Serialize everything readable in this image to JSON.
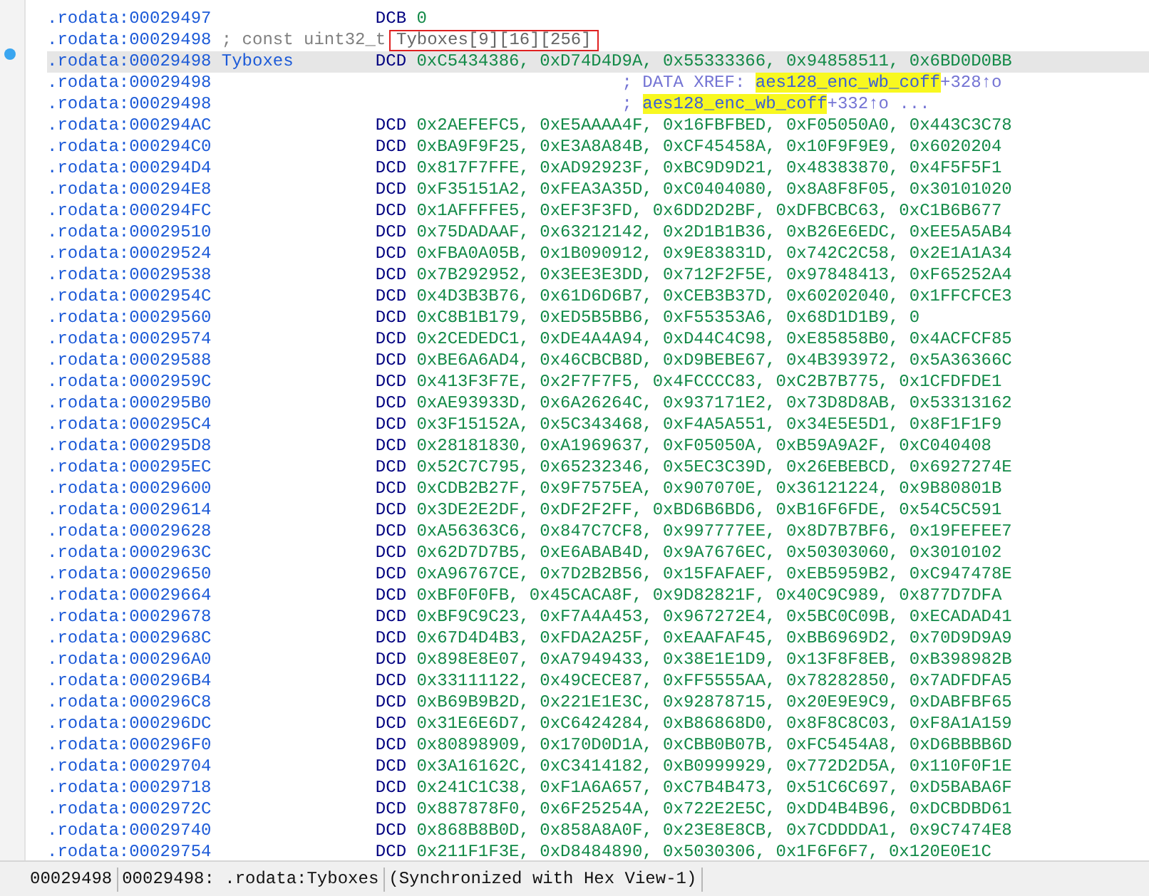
{
  "tooltip": {
    "text": "Tyboxes[9][16][256]"
  },
  "lines": [
    {
      "kind": "data",
      "address": ".rodata:00029497",
      "directive": "DCB",
      "operands": "0",
      "selected": false
    },
    {
      "kind": "comment",
      "address": ".rodata:00029498",
      "text": "; const uint32_t",
      "selected": false
    },
    {
      "kind": "data",
      "address": ".rodata:00029498",
      "label": "Tyboxes",
      "directive": "DCD",
      "operands": "0xC5434386, 0xD74D4D9A, 0x55333366, 0x94858511, 0x6BD0D0BB",
      "selected": true
    },
    {
      "kind": "xref",
      "address": ".rodata:00029498",
      "prefix": "; DATA XREF:",
      "target": "aes128_enc_wb_coff",
      "offset": "+328↑o",
      "selected": false
    },
    {
      "kind": "xref",
      "address": ".rodata:00029498",
      "prefix": ";",
      "target": "aes128_enc_wb_coff",
      "offset": "+332↑o ...",
      "selected": false
    },
    {
      "kind": "data",
      "address": ".rodata:000294AC",
      "directive": "DCD",
      "operands": "0x2AEFEFC5, 0xE5AAAA4F, 0x16FBFBED, 0xF05050A0, 0x443C3C78",
      "selected": false
    },
    {
      "kind": "data",
      "address": ".rodata:000294C0",
      "directive": "DCD",
      "operands": "0xBA9F9F25, 0xE3A8A84B, 0xCF45458A, 0x10F9F9E9, 0x6020204",
      "selected": false
    },
    {
      "kind": "data",
      "address": ".rodata:000294D4",
      "directive": "DCD",
      "operands": "0x817F7FFE, 0xAD92923F, 0xBC9D9D21, 0x48383870, 0x4F5F5F1",
      "selected": false
    },
    {
      "kind": "data",
      "address": ".rodata:000294E8",
      "directive": "DCD",
      "operands": "0xF35151A2, 0xFEA3A35D, 0xC0404080, 0x8A8F8F05, 0x30101020",
      "selected": false
    },
    {
      "kind": "data",
      "address": ".rodata:000294FC",
      "directive": "DCD",
      "operands": "0x1AFFFFE5, 0xEF3F3FD, 0x6DD2D2BF, 0xDFBCBC63, 0xC1B6B677",
      "selected": false
    },
    {
      "kind": "data",
      "address": ".rodata:00029510",
      "directive": "DCD",
      "operands": "0x75DADAAF, 0x63212142, 0x2D1B1B36, 0xB26E6EDC, 0xEE5A5AB4",
      "selected": false
    },
    {
      "kind": "data",
      "address": ".rodata:00029524",
      "directive": "DCD",
      "operands": "0xFBA0A05B, 0x1B090912, 0x9E83831D, 0x742C2C58, 0x2E1A1A34",
      "selected": false
    },
    {
      "kind": "data",
      "address": ".rodata:00029538",
      "directive": "DCD",
      "operands": "0x7B292952, 0x3EE3E3DD, 0x712F2F5E, 0x97848413, 0xF65252A4",
      "selected": false
    },
    {
      "kind": "data",
      "address": ".rodata:0002954C",
      "directive": "DCD",
      "operands": "0x4D3B3B76, 0x61D6D6B7, 0xCEB3B37D, 0x60202040, 0x1FFCFCE3",
      "selected": false
    },
    {
      "kind": "data",
      "address": ".rodata:00029560",
      "directive": "DCD",
      "operands": "0xC8B1B179, 0xED5B5BB6, 0xF55353A6, 0x68D1D1B9, 0",
      "selected": false
    },
    {
      "kind": "data",
      "address": ".rodata:00029574",
      "directive": "DCD",
      "operands": "0x2CEDEDC1, 0xDE4A4A94, 0xD44C4C98, 0xE85858B0, 0x4ACFCF85",
      "selected": false
    },
    {
      "kind": "data",
      "address": ".rodata:00029588",
      "directive": "DCD",
      "operands": "0xBE6A6AD4, 0x46CBCB8D, 0xD9BEBE67, 0x4B393972, 0x5A36366C",
      "selected": false
    },
    {
      "kind": "data",
      "address": ".rodata:0002959C",
      "directive": "DCD",
      "operands": "0x413F3F7E, 0x2F7F7F5, 0x4FCCCC83, 0xC2B7B775, 0x1CFDFDE1",
      "selected": false
    },
    {
      "kind": "data",
      "address": ".rodata:000295B0",
      "directive": "DCD",
      "operands": "0xAE93933D, 0x6A26264C, 0x937171E2, 0x73D8D8AB, 0x53313162",
      "selected": false
    },
    {
      "kind": "data",
      "address": ".rodata:000295C4",
      "directive": "DCD",
      "operands": "0x3F15152A, 0x5C343468, 0xF4A5A551, 0x34E5E5D1, 0x8F1F1F9",
      "selected": false
    },
    {
      "kind": "data",
      "address": ".rodata:000295D8",
      "directive": "DCD",
      "operands": "0x28181830, 0xA1969637, 0xF05050A, 0xB59A9A2F, 0xC040408",
      "selected": false
    },
    {
      "kind": "data",
      "address": ".rodata:000295EC",
      "directive": "DCD",
      "operands": "0x52C7C795, 0x65232346, 0x5EC3C39D, 0x26EBEBCD, 0x6927274E",
      "selected": false
    },
    {
      "kind": "data",
      "address": ".rodata:00029600",
      "directive": "DCD",
      "operands": "0xCDB2B27F, 0x9F7575EA, 0x907070E, 0x36121224, 0x9B80801B",
      "selected": false
    },
    {
      "kind": "data",
      "address": ".rodata:00029614",
      "directive": "DCD",
      "operands": "0x3DE2E2DF, 0xDF2F2FF, 0xBD6B6BD6, 0xB16F6FDE, 0x54C5C591",
      "selected": false
    },
    {
      "kind": "data",
      "address": ".rodata:00029628",
      "directive": "DCD",
      "operands": "0xA56363C6, 0x847C7CF8, 0x997777EE, 0x8D7B7BF6, 0x19FEFEE7",
      "selected": false
    },
    {
      "kind": "data",
      "address": ".rodata:0002963C",
      "directive": "DCD",
      "operands": "0x62D7D7B5, 0xE6ABAB4D, 0x9A7676EC, 0x50303060, 0x3010102",
      "selected": false
    },
    {
      "kind": "data",
      "address": ".rodata:00029650",
      "directive": "DCD",
      "operands": "0xA96767CE, 0x7D2B2B56, 0x15FAFAEF, 0xEB5959B2, 0xC947478E",
      "selected": false
    },
    {
      "kind": "data",
      "address": ".rodata:00029664",
      "directive": "DCD",
      "operands": "0xBF0F0FB, 0x45CACA8F, 0x9D82821F, 0x40C9C989, 0x877D7DFA",
      "selected": false
    },
    {
      "kind": "data",
      "address": ".rodata:00029678",
      "directive": "DCD",
      "operands": "0xBF9C9C23, 0xF7A4A453, 0x967272E4, 0x5BC0C09B, 0xECADAD41",
      "selected": false
    },
    {
      "kind": "data",
      "address": ".rodata:0002968C",
      "directive": "DCD",
      "operands": "0x67D4D4B3, 0xFDA2A25F, 0xEAAFAF45, 0xBB6969D2, 0x70D9D9A9",
      "selected": false
    },
    {
      "kind": "data",
      "address": ".rodata:000296A0",
      "directive": "DCD",
      "operands": "0x898E8E07, 0xA7949433, 0x38E1E1D9, 0x13F8F8EB, 0xB398982B",
      "selected": false
    },
    {
      "kind": "data",
      "address": ".rodata:000296B4",
      "directive": "DCD",
      "operands": "0x33111122, 0x49CECE87, 0xFF5555AA, 0x78282850, 0x7ADFDFA5",
      "selected": false
    },
    {
      "kind": "data",
      "address": ".rodata:000296C8",
      "directive": "DCD",
      "operands": "0xB69B9B2D, 0x221E1E3C, 0x92878715, 0x20E9E9C9, 0xDABFBF65",
      "selected": false
    },
    {
      "kind": "data",
      "address": ".rodata:000296DC",
      "directive": "DCD",
      "operands": "0x31E6E6D7, 0xC6424284, 0xB86868D0, 0x8F8C8C03, 0xF8A1A159",
      "selected": false
    },
    {
      "kind": "data",
      "address": ".rodata:000296F0",
      "directive": "DCD",
      "operands": "0x80898909, 0x170D0D1A, 0xCBB0B07B, 0xFC5454A8, 0xD6BBBB6D",
      "selected": false
    },
    {
      "kind": "data",
      "address": ".rodata:00029704",
      "directive": "DCD",
      "operands": "0x3A16162C, 0xC3414182, 0xB0999929, 0x772D2D5A, 0x110F0F1E",
      "selected": false
    },
    {
      "kind": "data",
      "address": ".rodata:00029718",
      "directive": "DCD",
      "operands": "0x241C1C38, 0xF1A6A657, 0xC7B4B473, 0x51C6C697, 0xD5BABA6F",
      "selected": false
    },
    {
      "kind": "data",
      "address": ".rodata:0002972C",
      "directive": "DCD",
      "operands": "0x887878F0, 0x6F25254A, 0x722E2E5C, 0xDD4B4B96, 0xDCBDBD61",
      "selected": false
    },
    {
      "kind": "data",
      "address": ".rodata:00029740",
      "directive": "DCD",
      "operands": "0x868B8B0D, 0x858A8A0F, 0x23E8E8CB, 0x7CDDDDA1, 0x9C7474E8",
      "selected": false
    },
    {
      "kind": "data",
      "address": ".rodata:00029754",
      "directive": "DCD",
      "operands": "0x211F1F3E, 0xD8484890, 0x5030306, 0x1F6F6F7, 0x120E0E1C",
      "selected": false
    }
  ],
  "status_bar": [
    "00029498",
    "00029498: .rodata:Tyboxes",
    "(Synchronized with Hex View-1)"
  ]
}
